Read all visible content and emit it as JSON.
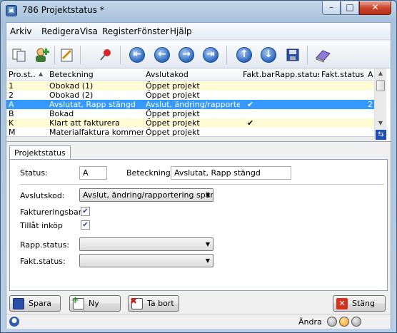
{
  "window": {
    "title": "786 Projektstatus *"
  },
  "menu": {
    "items": [
      {
        "label": "Arkiv"
      },
      {
        "label": "Redigera"
      },
      {
        "label": "Visa"
      },
      {
        "label": "Register"
      },
      {
        "label": "Fönster"
      },
      {
        "label": "Hjälp"
      }
    ]
  },
  "grid": {
    "columns": [
      "Pro.st...",
      "Beteckning",
      "Avslutakod",
      "Fakt.bar",
      "Rapp.status",
      "Fakt.status",
      "A"
    ],
    "rows": [
      {
        "code": "1",
        "name": "Obokad (1)",
        "avslutakod": "Öppet projekt",
        "faktbar": "",
        "a": "",
        "state": "yellow"
      },
      {
        "code": "2",
        "name": "Obokad (2)",
        "avslutakod": "Öppet projekt",
        "faktbar": "",
        "a": "",
        "state": "white"
      },
      {
        "code": "A",
        "name": "Avslutat, Rapp stängd",
        "avslutakod": "Avslut, ändring/rapporter...",
        "faktbar": "✔",
        "a": "2",
        "state": "selected"
      },
      {
        "code": "B",
        "name": "Bokad",
        "avslutakod": "Öppet projekt",
        "faktbar": "",
        "a": "",
        "state": "white"
      },
      {
        "code": "K",
        "name": "Klart att fakturera",
        "avslutakod": "Öppet projekt",
        "faktbar": "✔",
        "a": "",
        "state": "yellow"
      },
      {
        "code": "M",
        "name": "Materialfaktura kommer",
        "avslutakod": "Öppet projekt",
        "faktbar": "",
        "a": "",
        "state": "white"
      }
    ]
  },
  "tab": {
    "label": "Projektstatus"
  },
  "form": {
    "status_label": "Status:",
    "status_value": "A",
    "beteckning_label": "Beteckning:",
    "beteckning_value": "Avslutat, Rapp stängd",
    "avslutskod_label": "Avslutskod:",
    "avslutskod_value": "Avslut, ändring/rapportering spärra",
    "faktureringsbar_label": "Faktureringsbar",
    "faktureringsbar_checked": true,
    "tillat_label": "Tillåt inköp",
    "tillat_checked": true,
    "rapp_label": "Rapp.status:",
    "rapp_value": "",
    "fakt_label": "Fakt.status:",
    "fakt_value": ""
  },
  "buttons": {
    "save": "Spara",
    "new": "Ny",
    "delete": "Ta bort",
    "close": "Stäng"
  },
  "status": {
    "mode": "Ändra"
  },
  "colors": {
    "row_yellow": "#fffbd4",
    "row_selected": "#3399ff",
    "led_green": "#7cb342",
    "led_orange": "#ff9a1f"
  }
}
